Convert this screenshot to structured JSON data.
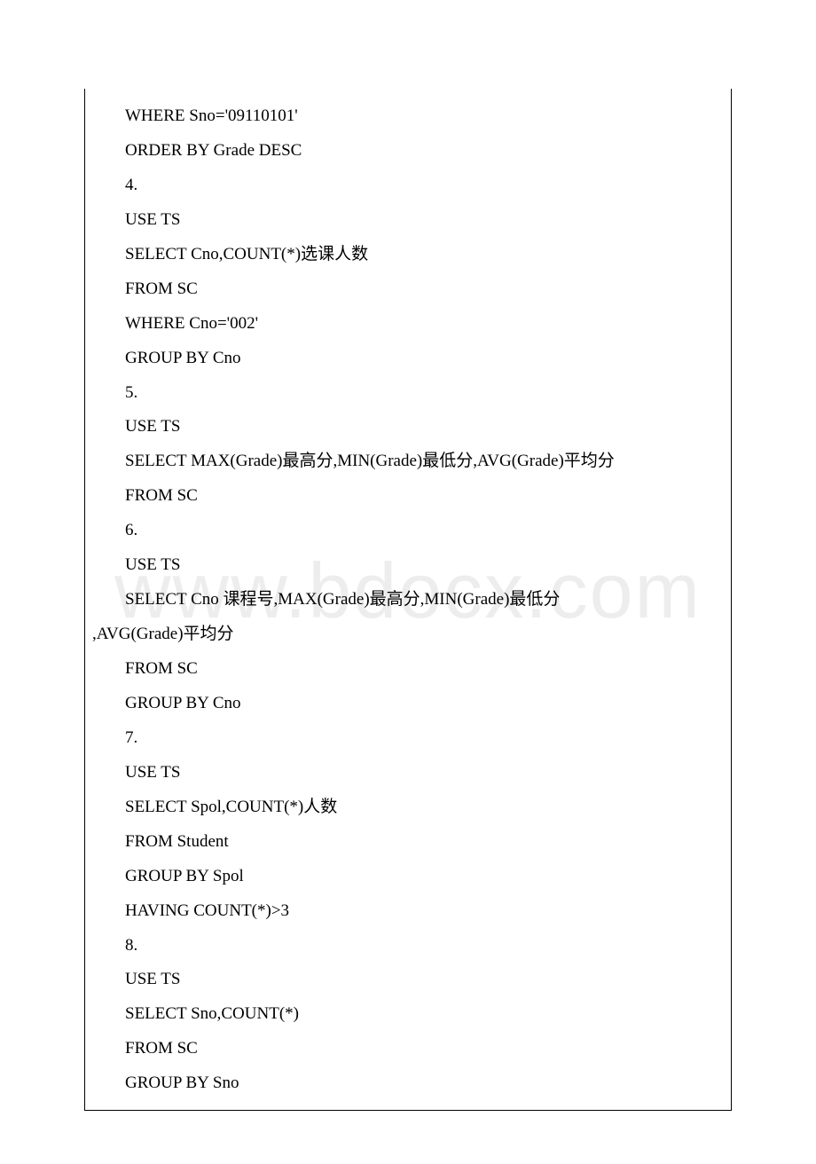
{
  "watermark": "www.bdocx.com",
  "lines": [
    {
      "text": "WHERE Sno='09110101'",
      "outdent": false
    },
    {
      "text": "ORDER BY Grade DESC",
      "outdent": false
    },
    {
      "text": "4.",
      "outdent": false
    },
    {
      "text": "USE TS",
      "outdent": false
    },
    {
      "text": "SELECT Cno,COUNT(*)选课人数",
      "outdent": false
    },
    {
      "text": "FROM SC",
      "outdent": false
    },
    {
      "text": "WHERE Cno='002'",
      "outdent": false
    },
    {
      "text": "GROUP BY Cno",
      "outdent": false
    },
    {
      "text": "5.",
      "outdent": false
    },
    {
      "text": "USE TS",
      "outdent": false
    },
    {
      "text": "SELECT MAX(Grade)最高分,MIN(Grade)最低分,AVG(Grade)平均分",
      "outdent": false
    },
    {
      "text": "FROM SC",
      "outdent": false
    },
    {
      "text": "6.",
      "outdent": false
    },
    {
      "text": "USE TS",
      "outdent": false
    },
    {
      "text": "SELECT Cno 课程号,MAX(Grade)最高分,MIN(Grade)最低分",
      "outdent": false
    },
    {
      "text": ",AVG(Grade)平均分",
      "outdent": true
    },
    {
      "text": "FROM SC",
      "outdent": false
    },
    {
      "text": "GROUP BY Cno",
      "outdent": false
    },
    {
      "text": "7.",
      "outdent": false
    },
    {
      "text": "USE TS",
      "outdent": false
    },
    {
      "text": "SELECT Spol,COUNT(*)人数",
      "outdent": false
    },
    {
      "text": "FROM Student",
      "outdent": false
    },
    {
      "text": "GROUP BY Spol",
      "outdent": false
    },
    {
      "text": "HAVING COUNT(*)>3",
      "outdent": false
    },
    {
      "text": "8.",
      "outdent": false
    },
    {
      "text": "USE TS",
      "outdent": false
    },
    {
      "text": "SELECT Sno,COUNT(*)",
      "outdent": false
    },
    {
      "text": "FROM SC",
      "outdent": false
    },
    {
      "text": "GROUP BY Sno",
      "outdent": false
    }
  ]
}
